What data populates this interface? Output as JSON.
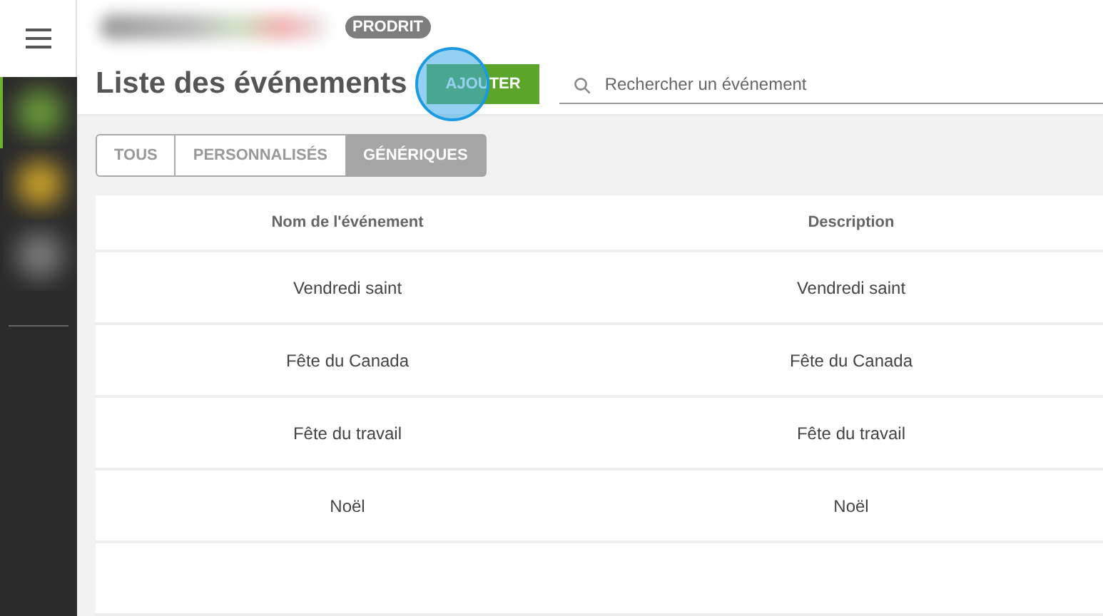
{
  "header": {
    "badge": "PRODRIT"
  },
  "sidebar": {
    "items": [
      {
        "selected": true
      },
      {
        "selected": false
      },
      {
        "selected": false
      }
    ]
  },
  "page": {
    "title": "Liste des événements",
    "add_button": "AJOUTER"
  },
  "search": {
    "placeholder": "Rechercher un événement"
  },
  "tabs": [
    {
      "label": "TOUS",
      "selected": false
    },
    {
      "label": "PERSONNALISÉS",
      "selected": false
    },
    {
      "label": "GÉNÉRIQUES",
      "selected": true
    }
  ],
  "table": {
    "columns": [
      "Nom de l'événement",
      "Description"
    ],
    "rows": [
      [
        "Vendredi saint",
        "Vendredi saint"
      ],
      [
        "Fête du Canada",
        "Fête du Canada"
      ],
      [
        "Fête du travail",
        "Fête du travail"
      ],
      [
        "Noël",
        "Noël"
      ]
    ]
  }
}
